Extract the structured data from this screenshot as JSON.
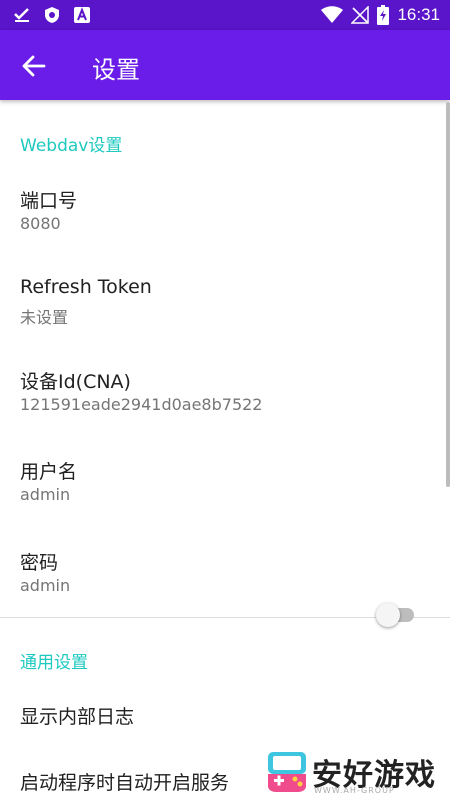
{
  "status_bar": {
    "time": "16:31",
    "left_icons": [
      "check-download-icon",
      "vpn-shield-icon",
      "a-icon"
    ],
    "right_icons": [
      "wifi-icon",
      "no-signal-icon",
      "battery-charging-icon"
    ]
  },
  "app_bar": {
    "title": "设置",
    "back_icon": "arrow-back-icon",
    "color": "#6a1de8"
  },
  "sections": {
    "webdav": {
      "title": "Webdav设置",
      "items": [
        {
          "title": "端口号",
          "summary": "8080"
        },
        {
          "title": "Refresh Token",
          "summary": "未设置"
        },
        {
          "title": "设备Id(CNA)",
          "summary": "121591eade2941d0ae8b7522"
        },
        {
          "title": "用户名",
          "summary": "admin"
        },
        {
          "title": "密码",
          "summary": "admin"
        }
      ]
    },
    "general": {
      "title": "通用设置",
      "items": [
        {
          "title": "显示内部日志",
          "switch_on": false
        },
        {
          "title": "启动程序时自动开启服务"
        }
      ]
    }
  },
  "watermark": {
    "text": "安好游戏",
    "url": "WWW.AH-GROUP"
  },
  "accent_color": "#1ec9c0"
}
